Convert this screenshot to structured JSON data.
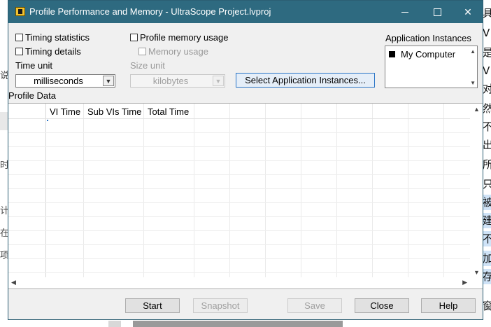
{
  "window": {
    "title": "Profile Performance and Memory - UltraScope Project.lvproj"
  },
  "options": {
    "timing_statistics": "Timing statistics",
    "timing_details": "Timing details",
    "profile_memory_usage": "Profile memory usage",
    "memory_usage": "Memory usage"
  },
  "time_unit": {
    "label": "Time unit",
    "value": "milliseconds"
  },
  "size_unit": {
    "label": "Size unit",
    "value": "kilobytes"
  },
  "select_instances_label": "Select Application Instances...",
  "app_instances": {
    "label": "Application Instances",
    "items": [
      "My Computer"
    ]
  },
  "profile_data": {
    "label": "Profile Data",
    "columns": [
      "",
      "VI Time",
      "Sub VIs Time",
      "Total Time"
    ]
  },
  "buttons": {
    "start": "Start",
    "snapshot": "Snapshot",
    "save": "Save",
    "close": "Close",
    "help": "Help"
  },
  "background": {
    "left_chars": [
      "说",
      "时",
      "计",
      "在",
      "项"
    ],
    "right_chars": [
      "具",
      "V",
      "是",
      "V",
      "对",
      "然",
      "不",
      "出",
      "所",
      "只",
      "被",
      "建",
      "不",
      "加",
      "存",
      "窗"
    ]
  }
}
